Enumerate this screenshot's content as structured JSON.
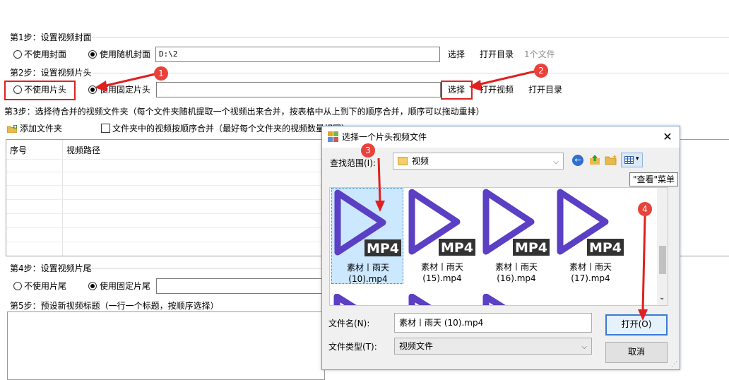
{
  "step1": {
    "title": "第1步：设置视频封面",
    "opt_none": "不使用封面",
    "opt_random": "使用随机封面",
    "path_value": "D:\\2",
    "select_label": "选择",
    "open_dir_label": "打开目录",
    "file_count": "1个文件"
  },
  "step2": {
    "title": "第2步：设置视频片头",
    "opt_none": "不使用片头",
    "opt_fixed": "使用固定片头",
    "path_value": "",
    "select_label": "选择",
    "open_video_label": "打开视频",
    "open_dir_label": "打开目录"
  },
  "step3": {
    "title": "第3步：选择待合并的视频文件夹（每个文件夹随机提取一个视频出来合并，按表格中从上到下的顺序合并，顺序可以拖动重排）",
    "add_folder_label": "添加文件夹",
    "order_checkbox_label": "文件夹中的视频按顺序合并（最好每个文件夹的视频数量相同）",
    "col_index": "序号",
    "col_path": "视频路径"
  },
  "step4": {
    "title": "第4步：设置视频片尾",
    "opt_none": "不使用片尾",
    "opt_fixed": "使用固定片尾"
  },
  "step5": {
    "title": "第5步：预设新视频标题（一行一个标题，按顺序选择）"
  },
  "dialog": {
    "title": "选择一个片头视频文件",
    "lookin_label": "查找范围(I):",
    "lookin_value": "视频",
    "view_menu_tooltip": "\"查看\"菜单",
    "files": [
      {
        "name": "素材丨雨天 (10).mp4",
        "line1": "素材丨雨天",
        "line2": "(10).mp4"
      },
      {
        "name": "素材丨雨天 (15).mp4",
        "line1": "素材丨雨天",
        "line2": "(15).mp4"
      },
      {
        "name": "素材丨雨天 (16).mp4",
        "line1": "素材丨雨天",
        "line2": "(16).mp4"
      },
      {
        "name": "素材丨雨天 (17).mp4",
        "line1": "素材丨雨天",
        "line2": "(17).mp4"
      }
    ],
    "thumb_badge": "MP4",
    "filename_label": "文件名(N):",
    "filename_value": "素材丨雨天 (10).mp4",
    "filetype_label": "文件类型(T):",
    "filetype_value": "视频文件",
    "open_label": "打开(O)",
    "cancel_label": "取消"
  },
  "annotations": [
    "1",
    "2",
    "3",
    "4"
  ],
  "colors": {
    "annotation_red": "#e02020",
    "play_icon_purple": "#5b3fc4"
  }
}
